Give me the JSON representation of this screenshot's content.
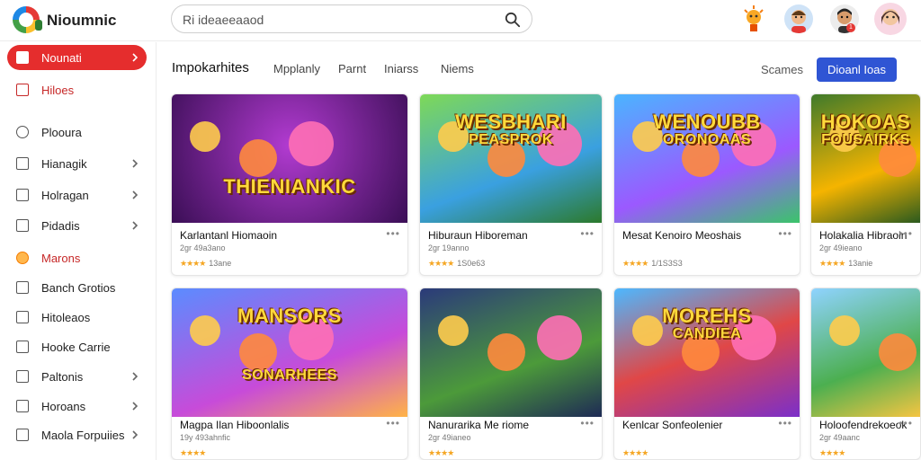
{
  "header": {
    "brand": "Nioumnic",
    "search_value": "Ri ideaeeaaod",
    "badge_count": "1"
  },
  "sidebar": {
    "items": [
      {
        "label": "Nounati",
        "state": "active"
      },
      {
        "label": "Hiloes",
        "state": "red"
      },
      {
        "label": "Plooura"
      },
      {
        "label": "Hianagik",
        "chevron": true
      },
      {
        "label": "Holragan",
        "chevron": true
      },
      {
        "label": "Pidadis",
        "chevron": true
      },
      {
        "label": "Marons",
        "state": "orange"
      },
      {
        "label": "Banch Grotios"
      },
      {
        "label": "Hitoleaos"
      },
      {
        "label": "Hooke Carrie"
      },
      {
        "label": "Paltonis",
        "chevron": true
      },
      {
        "label": "Horoans",
        "chevron": true
      },
      {
        "label": "Maola Forpuiies",
        "chevron": true
      }
    ]
  },
  "tabs": {
    "items": [
      "Impokarhites",
      "Mpplanly",
      "Parnt",
      "Iniarss",
      "Niems"
    ],
    "right_label": "Scames",
    "cta_label": "Dioanl Ioas"
  },
  "cards": [
    {
      "thumb_text": "THIENIANKIC",
      "title": "Karlantanl Hiomaoin",
      "meta": "2gr 49a3ano",
      "rating": "4.5",
      "rating_text": "13ane"
    },
    {
      "thumb_text": "WESBHARI",
      "thumb_text2": "PEASPROK",
      "title": "Hiburaun Hiboreman",
      "meta": "2gr 19anno",
      "rating": "4.5",
      "rating_text": "1S0e63"
    },
    {
      "thumb_text": "WENOUBB",
      "thumb_text2": "ORONOAAS",
      "title": "Mesat Kenoiro Meoshais",
      "meta": "",
      "rating": "4.5",
      "rating_text": "1/1S3S3"
    },
    {
      "thumb_text": "HOKOAS",
      "thumb_text2": "FOUSAIRKS",
      "title": "Holakalia Hibraoin",
      "meta": "2gr 49ieano",
      "rating": "4.5",
      "rating_text": "13anie"
    },
    {
      "thumb_text": "MANSORS",
      "thumb_text2": "SONARHEES",
      "title": "Magpa Ilan Hiboonlalis",
      "meta": "19y 493ahnfic",
      "rating": "4.5",
      "rating_text": ""
    },
    {
      "thumb_text": "",
      "title": "Nanurarika Me riome",
      "meta": "2gr 49ianeo",
      "rating": "4.5",
      "rating_text": ""
    },
    {
      "thumb_text": "MOREHS",
      "thumb_text2": "CANDIEA",
      "title": "Kenlcar Sonfeolenier",
      "meta": "",
      "rating": "4.5",
      "rating_text": ""
    },
    {
      "thumb_text": "",
      "title": "Holoofendrekoeok",
      "meta": "2gr 49aanc",
      "rating": "4.5",
      "rating_text": ""
    }
  ],
  "colors": {
    "accent_red": "#e52d2d",
    "cta_blue": "#2f55d4",
    "star": "#f5a623"
  }
}
